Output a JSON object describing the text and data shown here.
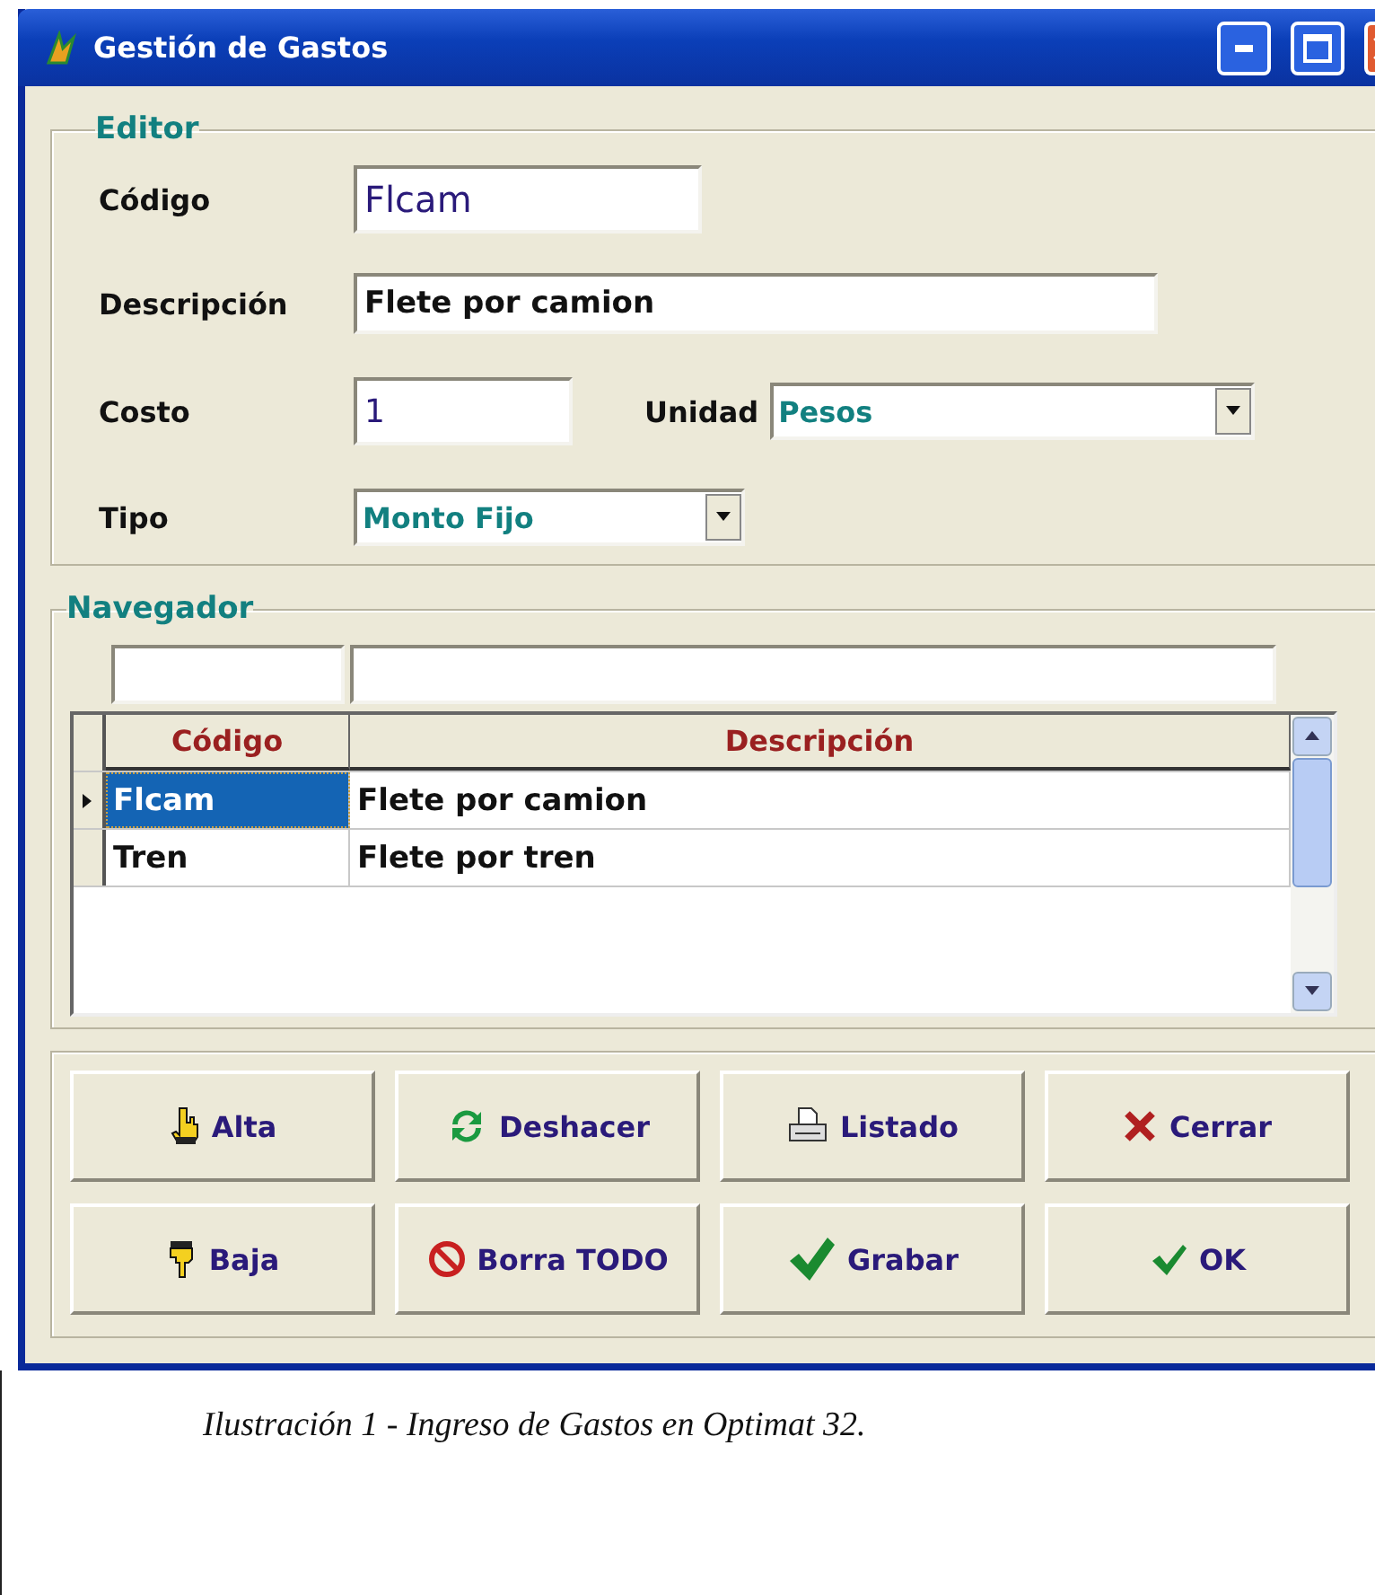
{
  "window": {
    "title": "Gestión de Gastos"
  },
  "editor": {
    "title": "Editor",
    "codigo": {
      "label": "Código",
      "value": "Flcam"
    },
    "descripcion": {
      "label": "Descripción",
      "value": "Flete por camion"
    },
    "costo": {
      "label": "Costo",
      "value": "1"
    },
    "unidad": {
      "label": "Unidad",
      "value": "Pesos"
    },
    "tipo": {
      "label": "Tipo",
      "value": "Monto Fijo"
    }
  },
  "navegador": {
    "title": "Navegador",
    "columns": [
      "Código",
      "Descripción"
    ],
    "rows": [
      {
        "codigo": "Flcam",
        "descripcion": "Flete por camion",
        "selected": true
      },
      {
        "codigo": "Tren",
        "descripcion": "Flete por tren",
        "selected": false
      }
    ]
  },
  "buttons": [
    "Alta",
    "Deshacer",
    "Listado",
    "Cerrar",
    "Baja",
    "Borra TODO",
    "Grabar",
    "OK"
  ],
  "caption": "Ilustración 1 - Ingreso de Gastos en Optimat 32."
}
